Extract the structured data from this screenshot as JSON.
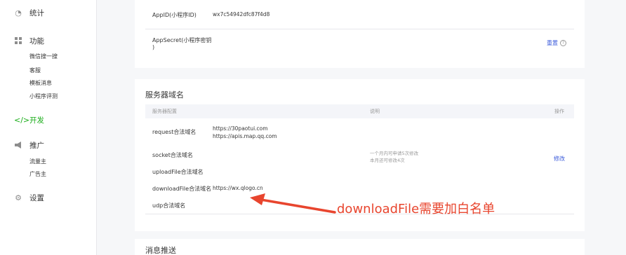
{
  "sidebar": {
    "items": [
      {
        "label": "统计",
        "icon": "pie-chart-icon"
      },
      {
        "label": "功能",
        "icon": "grid-icon"
      },
      {
        "label": "开发",
        "icon": "code-icon",
        "active": true
      },
      {
        "label": "推广",
        "icon": "megaphone-icon"
      },
      {
        "label": "设置",
        "icon": "gear-icon"
      }
    ],
    "feature_subitems": [
      "微信搜一搜",
      "客服",
      "模板消息",
      "小程序评测"
    ],
    "promo_subitems": [
      "流量主",
      "广告主"
    ]
  },
  "appinfo": {
    "appid_label": "AppID(小程序ID)",
    "appid_value": "wx7c54942dfc87f4d8",
    "secret_label_line1": "AppSecret(小程序密钥",
    "secret_label_line2": ")",
    "reset_label": "重置",
    "help_glyph": "?"
  },
  "server_domain": {
    "title": "服务器域名",
    "headers": {
      "config": "服务器配置",
      "desc": "说明",
      "action": "操作"
    },
    "request_label": "request合法域名",
    "request_values": [
      "https://30paotui.com",
      "https://apis.map.qq.com"
    ],
    "socket_label": "socket合法域名",
    "upload_label": "uploadFile合法域名",
    "download_label": "downloadFile合法域名",
    "download_value": "https://wx.qlogo.cn",
    "udp_label": "udp合法域名",
    "note_line1": "一个月内可申请5次修改",
    "note_line2": "本月还可修改4次",
    "modify_label": "修改"
  },
  "next_section_title": "消息推送",
  "annotation": {
    "text": "downloadFile需要加白名单",
    "color": "#e8452e"
  },
  "colors": {
    "accent_green": "#1aad19",
    "link_blue": "#3b5bdb"
  }
}
